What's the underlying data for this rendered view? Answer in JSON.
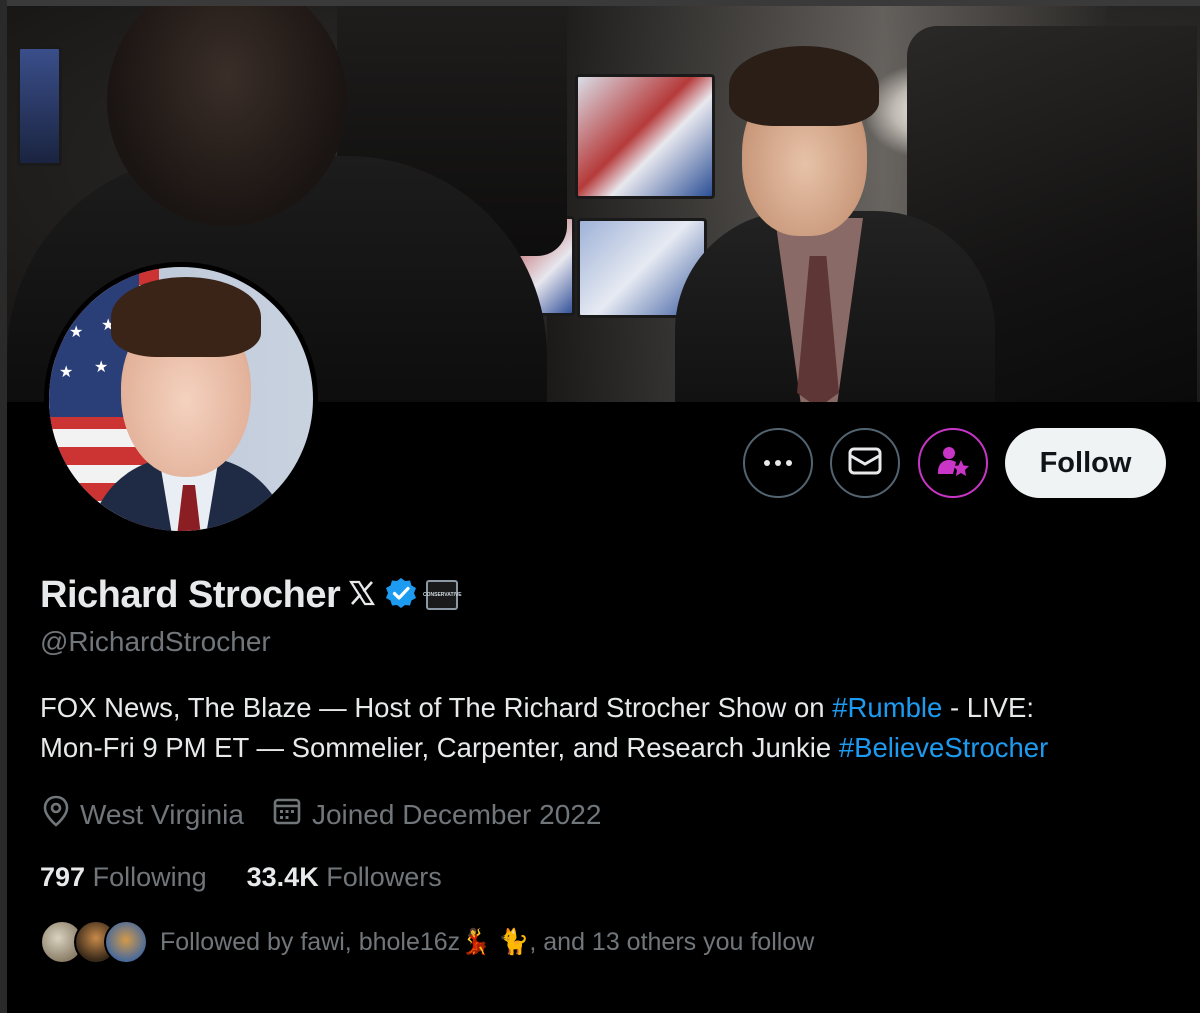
{
  "profile": {
    "display_name": "Richard Strocher",
    "handle": "@RichardStrocher",
    "affiliation_badge_text": "CONSERVATIVE",
    "verified_color": "#1d9bf0",
    "bio": {
      "part1": "FOX News, The Blaze — Host of The Richard Strocher Show on ",
      "hashtag1": "#Rumble",
      "part2": " - LIVE:",
      "part3": "Mon-Fri 9 PM ET — Sommelier, Carpenter, and Research Junkie ",
      "hashtag2": "#BelieveStrocher"
    },
    "location": "West Virginia",
    "joined": "Joined December 2022",
    "following_count": "797",
    "following_label": "Following",
    "followers_count": "33.4K",
    "followers_label": "Followers",
    "followed_by": "Followed by fawi, bhole16z💃 🐈, and 13 others you follow"
  },
  "actions": {
    "follow_label": "Follow",
    "more_icon": "more-icon",
    "message_icon": "envelope-icon",
    "subscribe_icon": "subscribe-person-star-icon",
    "subscribe_color": "#c936c7"
  }
}
